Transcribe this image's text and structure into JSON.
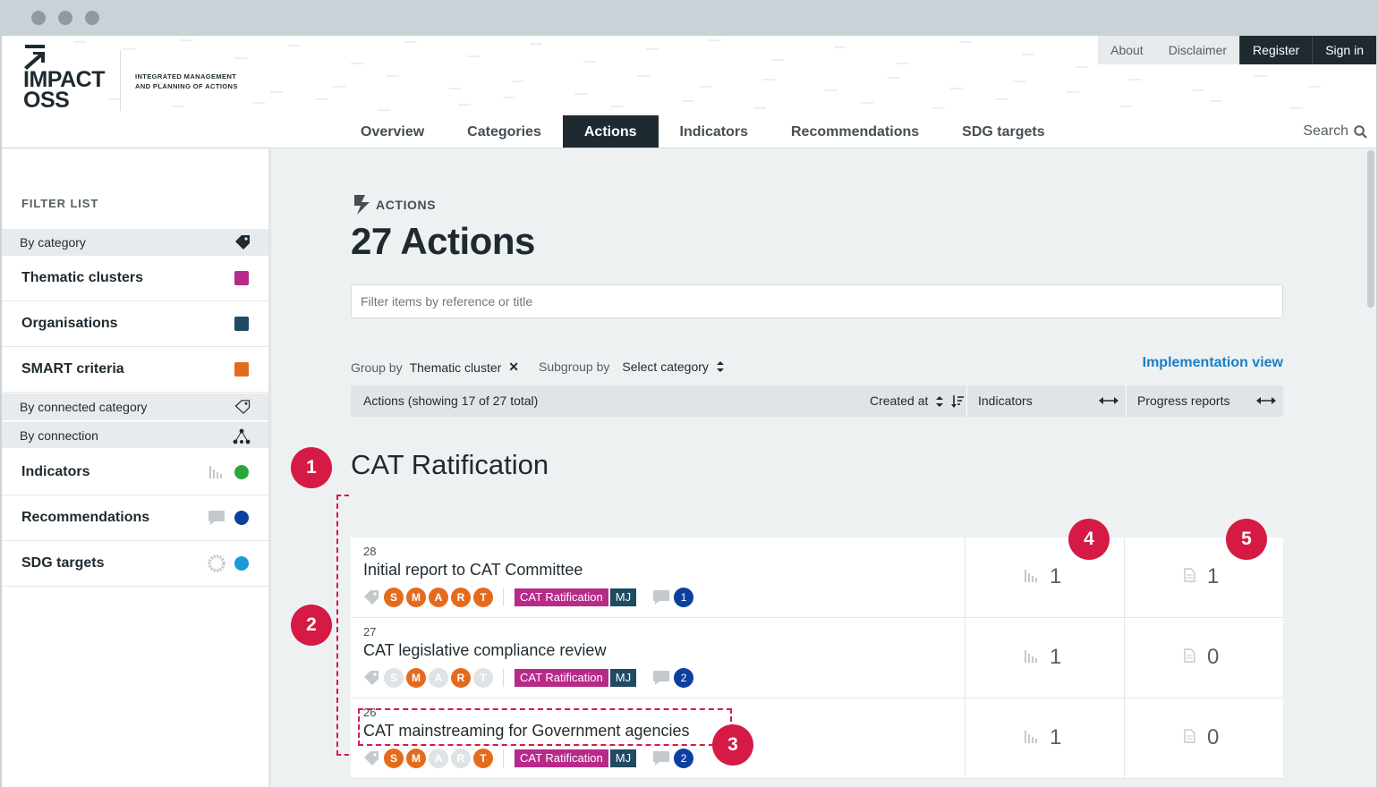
{
  "header": {
    "logo_line1": "IMPACT",
    "logo_line2": "OSS",
    "claim_line1": "INTEGRATED MANAGEMENT",
    "claim_line2": "AND PLANNING OF ACTIONS",
    "top_links": [
      "About",
      "Disclaimer",
      "Register",
      "Sign in"
    ],
    "nav_tabs": [
      "Overview",
      "Categories",
      "Actions",
      "Indicators",
      "Recommendations",
      "SDG targets"
    ],
    "active_tab": "Actions",
    "search_label": "Search"
  },
  "sidebar": {
    "title": "FILTER LIST",
    "group_by_category": "By category",
    "category_items": [
      {
        "label": "Thematic clusters",
        "color": "#b72a8a"
      },
      {
        "label": "Organisations",
        "color": "#1e4a62"
      },
      {
        "label": "SMART criteria",
        "color": "#e46b1c"
      }
    ],
    "group_by_connected_category": "By connected category",
    "group_by_connection": "By connection",
    "connection_items": [
      {
        "label": "Indicators",
        "color": "#2aa63c",
        "icon": "bar-chart-icon"
      },
      {
        "label": "Recommendations",
        "color": "#0d3fa0",
        "icon": "comment-icon"
      },
      {
        "label": "SDG targets",
        "color": "#1a9ad6",
        "icon": "sdg-wheel-icon"
      }
    ]
  },
  "main": {
    "kicker": "ACTIONS",
    "title": "27 Actions",
    "filter_placeholder": "Filter items by reference or title",
    "group_by_label": "Group by",
    "group_by_value": "Thematic cluster",
    "subgroup_by_label": "Subgroup by",
    "subgroup_by_value": "Select category",
    "implementation_view": "Implementation view",
    "list_header": {
      "summary": "Actions (showing 17 of 27 total)",
      "sort_label": "Created at",
      "col_indicators": "Indicators",
      "col_progress": "Progress reports"
    },
    "group_title": "CAT Ratification",
    "rows": [
      {
        "ref": "28",
        "title": "Initial report to CAT Committee",
        "smart": [
          "S",
          "M",
          "A",
          "R",
          "T"
        ],
        "smart_on": [
          true,
          true,
          true,
          true,
          true
        ],
        "category": "CAT Ratification",
        "org": "MJ",
        "comments": "1",
        "indicators": "1",
        "progress": "1"
      },
      {
        "ref": "27",
        "title": "CAT legislative compliance review",
        "smart": [
          "S",
          "M",
          "A",
          "R",
          "T"
        ],
        "smart_on": [
          false,
          true,
          false,
          true,
          false
        ],
        "category": "CAT Ratification",
        "org": "MJ",
        "comments": "2",
        "indicators": "1",
        "progress": "0"
      },
      {
        "ref": "26",
        "title": "CAT mainstreaming for Government agencies",
        "smart": [
          "S",
          "M",
          "A",
          "R",
          "T"
        ],
        "smart_on": [
          true,
          true,
          false,
          false,
          true
        ],
        "category": "CAT Ratification",
        "org": "MJ",
        "comments": "2",
        "indicators": "1",
        "progress": "0"
      }
    ]
  },
  "annotations": [
    "1",
    "2",
    "3",
    "4",
    "5"
  ],
  "colors": {
    "accent": "#d51a45",
    "dark": "#1f2a30",
    "link": "#1a7ec6",
    "smart_on": "#e46b1c"
  }
}
